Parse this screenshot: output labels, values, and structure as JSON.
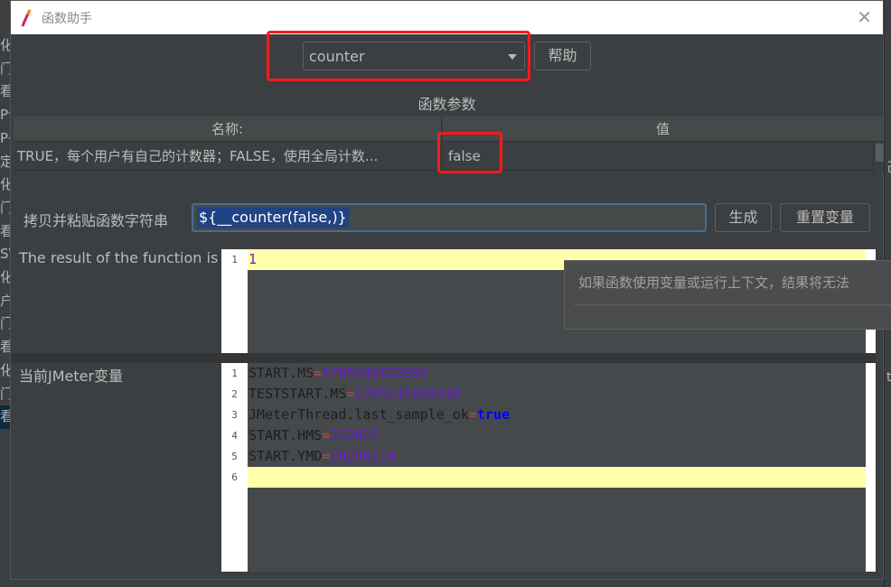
{
  "background_window": {
    "left_fragments": [
      "化",
      "门",
      "看",
      "P讠",
      "P亻",
      "定",
      "化",
      "门",
      "看",
      "SV",
      "化",
      "户",
      "门",
      "看",
      "化",
      "门",
      "看"
    ],
    "right_fragments": [
      "己",
      "ts"
    ]
  },
  "dialog": {
    "title": "函数助手",
    "function_select": {
      "value": "counter"
    },
    "help_button": "帮助",
    "params_title": "函数参数",
    "table": {
      "columns": [
        "名称:",
        "值"
      ],
      "rows": [
        {
          "name": "TRUE，每个用户有自己的计数器；FALSE，使用全局计数...",
          "value": "false"
        }
      ]
    },
    "copy_label": "拷贝并粘贴函数字符串",
    "function_string": "${__counter(false,)}",
    "generate_button": "生成",
    "reset_button": "重置变量",
    "result_label": "The result of the function is",
    "result_lines": [
      "1"
    ],
    "tooltip": "如果函数使用变量或运行上下文，结果将无法",
    "vars_label": "当前JMeter变量",
    "variables": [
      {
        "key": "START.MS",
        "value": "1705242022892"
      },
      {
        "key": "TESTSTART.MS",
        "value": "1705245665410"
      },
      {
        "key": "JMeterThread.last_sample_ok",
        "value": "true"
      },
      {
        "key": "START.HMS",
        "value": "222022"
      },
      {
        "key": "START.YMD",
        "value": "20240114"
      }
    ],
    "line_numbers": [
      "1",
      "2",
      "3",
      "4",
      "5",
      "6"
    ]
  },
  "colors": {
    "highlight": "#ff1a1a",
    "selection": "#214283",
    "current_line": "#ffffaa"
  }
}
